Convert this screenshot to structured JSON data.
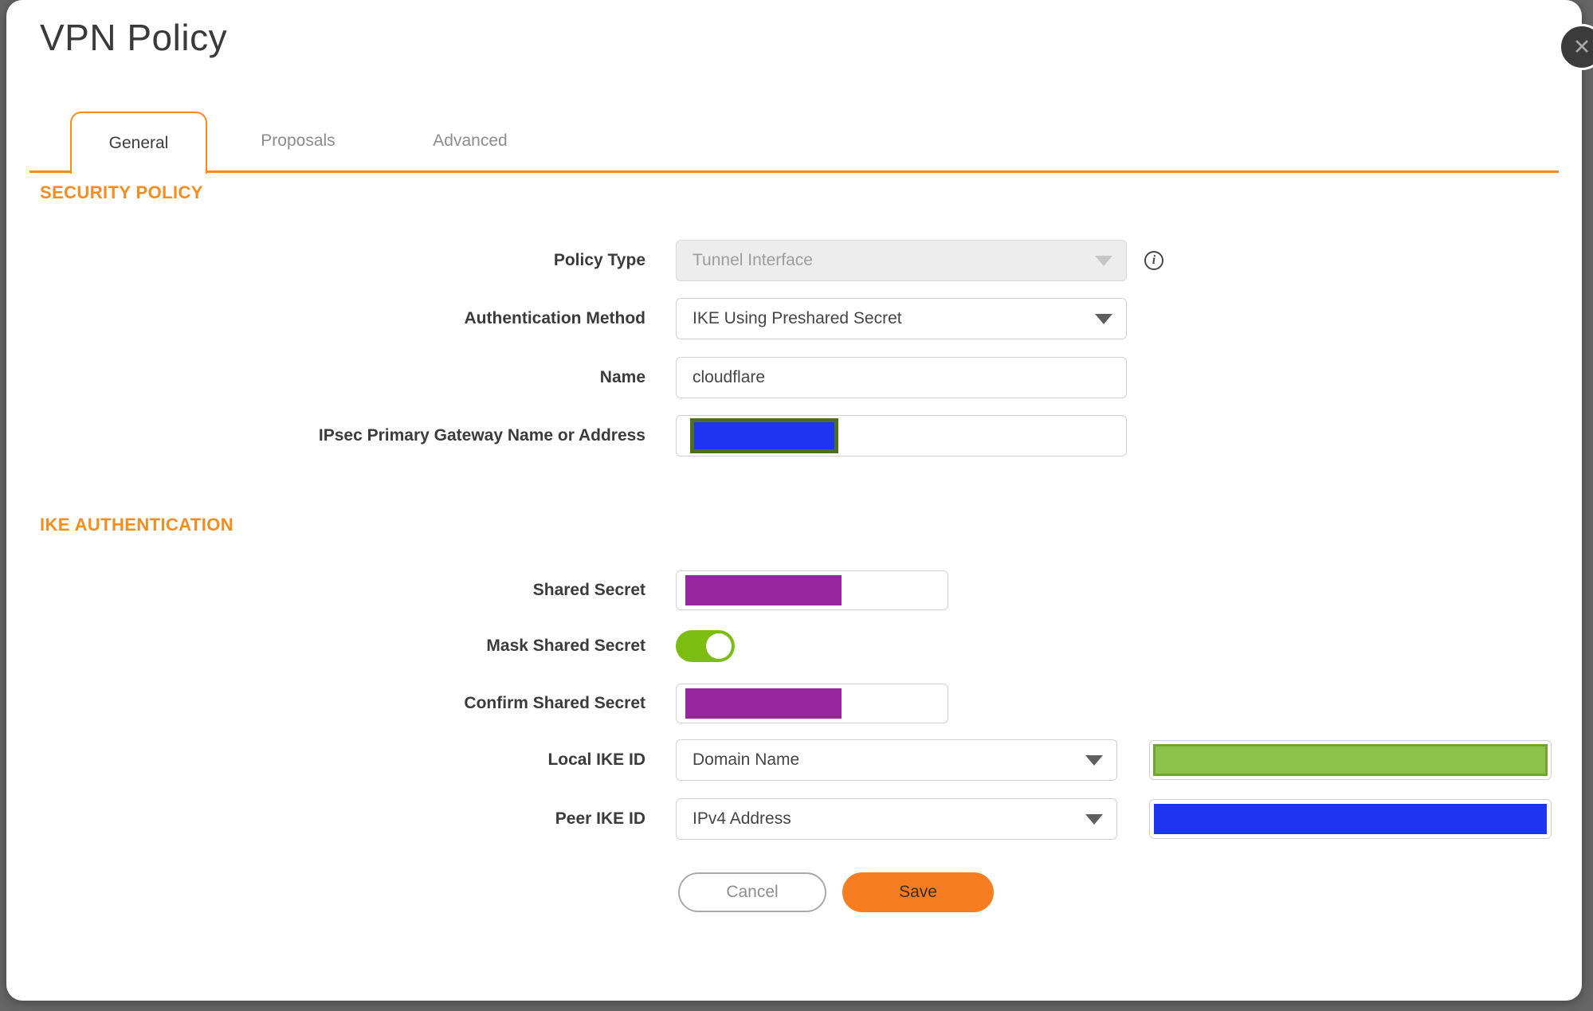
{
  "title": "VPN Policy",
  "icons": {
    "close": "✕",
    "info": "i"
  },
  "tabs": [
    {
      "label": "General",
      "active": true
    },
    {
      "label": "Proposals",
      "active": false
    },
    {
      "label": "Advanced",
      "active": false
    }
  ],
  "sections": {
    "security_policy": "SECURITY POLICY",
    "ike_authentication": "IKE AUTHENTICATION"
  },
  "fields": {
    "policy_type": {
      "label": "Policy Type",
      "value": "Tunnel Interface",
      "disabled": true
    },
    "authentication_method": {
      "label": "Authentication Method",
      "value": "IKE Using Preshared Secret"
    },
    "name": {
      "label": "Name",
      "value": "cloudflare"
    },
    "ipsec_primary_gateway": {
      "label": "IPsec Primary Gateway Name or Address",
      "value_redacted": true
    },
    "shared_secret": {
      "label": "Shared Secret",
      "value_redacted": true
    },
    "mask_shared_secret": {
      "label": "Mask Shared Secret",
      "state": "on"
    },
    "confirm_shared_secret": {
      "label": "Confirm Shared Secret",
      "value_redacted": true
    },
    "local_ike_id": {
      "label": "Local IKE ID",
      "value": "Domain Name",
      "id_value_redacted": true
    },
    "peer_ike_id": {
      "label": "Peer IKE ID",
      "value": "IPv4 Address",
      "id_value_redacted": true
    }
  },
  "buttons": {
    "cancel": "Cancel",
    "save": "Save"
  },
  "colors": {
    "accent": "#f68b1e",
    "save": "#f57c1f",
    "toggle-green": "#7cbd11",
    "redact-purple": "#97279f",
    "redact-blue": "#1d34f1",
    "redact-green": "#8cc24c",
    "redact-green-border": "#70a52f",
    "redact-olive-border": "#4d6e1f",
    "backdrop": "#656565"
  }
}
